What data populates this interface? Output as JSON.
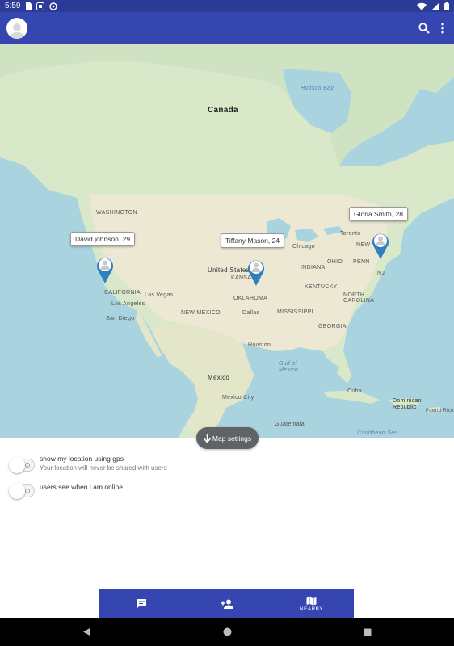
{
  "status_bar": {
    "time": "5:59",
    "icons_left": [
      "sd-card-icon",
      "app-badge-icon",
      "sync-icon"
    ],
    "icons_right": [
      "wifi-icon",
      "signal-icon",
      "battery-icon"
    ]
  },
  "app_bar": {
    "avatar": "avatar-icon",
    "actions": [
      "search-icon",
      "more-vert-icon"
    ]
  },
  "map": {
    "labels": {
      "canada": "Canada",
      "hudson_bay": "Hudson Bay",
      "united_states": "United States",
      "mexico": "Mexico",
      "mexico_city": "Mexico City",
      "gulf_of_mexico": "Gulf of\nMexico",
      "caribbean_sea": "Caribbean Sea",
      "dominican_republic": "Dominican\nRepublic",
      "puerto_rico": "Puerto Rico",
      "los_angeles": "Los Angeles",
      "las_vegas": "Las Vegas",
      "san_diego": "San Diego",
      "dallas": "Dallas",
      "houston": "Houston",
      "chicago": "Chicago",
      "toronto": "Toronto",
      "washington": "WASHINGTON",
      "california": "CALIFORNIA",
      "new_mexico": "NEW MEXICO",
      "kansas": "KANSAS",
      "oklahoma": "OKLAHOMA",
      "indiana": "INDIANA",
      "ohio": "OHIO",
      "kentucky": "KENTUCKY",
      "north_carolina": "NORTH\nCAROLINA",
      "georgia": "GEORGIA",
      "mississippi": "MISSISSIPPI",
      "penn": "PENN",
      "new_york": "NEW YORK",
      "nj": "NJ",
      "cuba": "Cuba",
      "guatemala": "Guatemala"
    },
    "markers": [
      {
        "label": "David johnson, 29"
      },
      {
        "label": "Tiffany Mason, 24"
      },
      {
        "label": "Gloria Smith, 28"
      }
    ],
    "settings_button": "Map settings"
  },
  "settings": [
    {
      "title": "show my location using gps",
      "subtitle": "Your location will never be shared with users",
      "enabled": false
    },
    {
      "title": "users see when i am online",
      "subtitle": "",
      "enabled": false
    }
  ],
  "bottom_nav": {
    "items": [
      {
        "icon": "chat-icon",
        "label": ""
      },
      {
        "icon": "person-add-icon",
        "label": ""
      },
      {
        "icon": "map-icon",
        "label": "NEARBY",
        "active": true
      }
    ]
  },
  "colors": {
    "primary": "#3546b0",
    "primary_dark": "#2c3a98",
    "marker": "#2f7fc1",
    "chip": "#5f6368"
  }
}
